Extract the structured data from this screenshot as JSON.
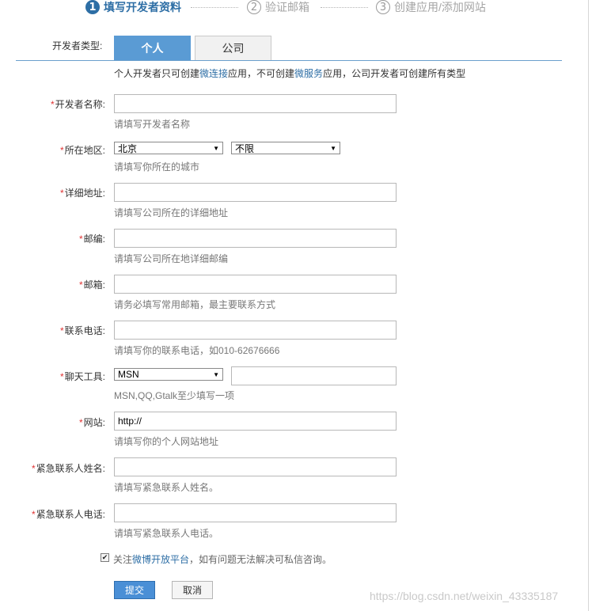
{
  "steps": [
    {
      "num": "1",
      "label": "填写开发者资料"
    },
    {
      "num": "2",
      "label": "验证邮箱"
    },
    {
      "num": "3",
      "label": "创建应用/添加网站"
    }
  ],
  "dev_type": {
    "label": "开发者类型:",
    "tabs": [
      "个人",
      "公司"
    ],
    "selected": "个人",
    "note_prefix": "个人开发者只可创建",
    "note_link1": "微连接",
    "note_mid": "应用，不可创建",
    "note_link2": "微服务",
    "note_suffix": "应用，公司开发者可创建所有类型"
  },
  "required_mark": "*",
  "fields": {
    "dev_name": {
      "label": "开发者名称:",
      "value": "",
      "hint": "请填写开发者名称"
    },
    "region": {
      "label": "所在地区:",
      "province": "北京",
      "city": "不限",
      "hint": "请填写你所在的城市"
    },
    "address": {
      "label": "详细地址:",
      "value": "",
      "hint": "请填写公司所在的详细地址"
    },
    "postcode": {
      "label": "邮编:",
      "value": "",
      "hint": "请填写公司所在地详细邮编"
    },
    "email": {
      "label": "邮箱:",
      "value": "",
      "hint": "请务必填写常用邮箱，最主要联系方式"
    },
    "phone": {
      "label": "联系电话:",
      "value": "",
      "hint": "请填写你的联系电话，如010-62676666"
    },
    "im": {
      "label": "聊天工具:",
      "tool": "MSN",
      "value": "",
      "hint": "MSN,QQ,Gtalk至少填写一项"
    },
    "website": {
      "label": "网站:",
      "value": "http://",
      "hint": "请填写你的个人网站地址"
    },
    "emergency_name": {
      "label": "紧急联系人姓名:",
      "value": "",
      "hint": "请填写紧急联系人姓名。"
    },
    "emergency_phone": {
      "label": "紧急联系人电话:",
      "value": "",
      "hint": "请填写紧急联系人电话。"
    }
  },
  "follow": {
    "checked": true,
    "check_glyph": "✔",
    "prefix": "关注",
    "link": "微博开放平台",
    "suffix": "，如有问题无法解决可私信咨询。"
  },
  "buttons": {
    "submit": "提交",
    "cancel": "取消"
  },
  "watermark": "https://blog.csdn.net/weixin_43335187"
}
